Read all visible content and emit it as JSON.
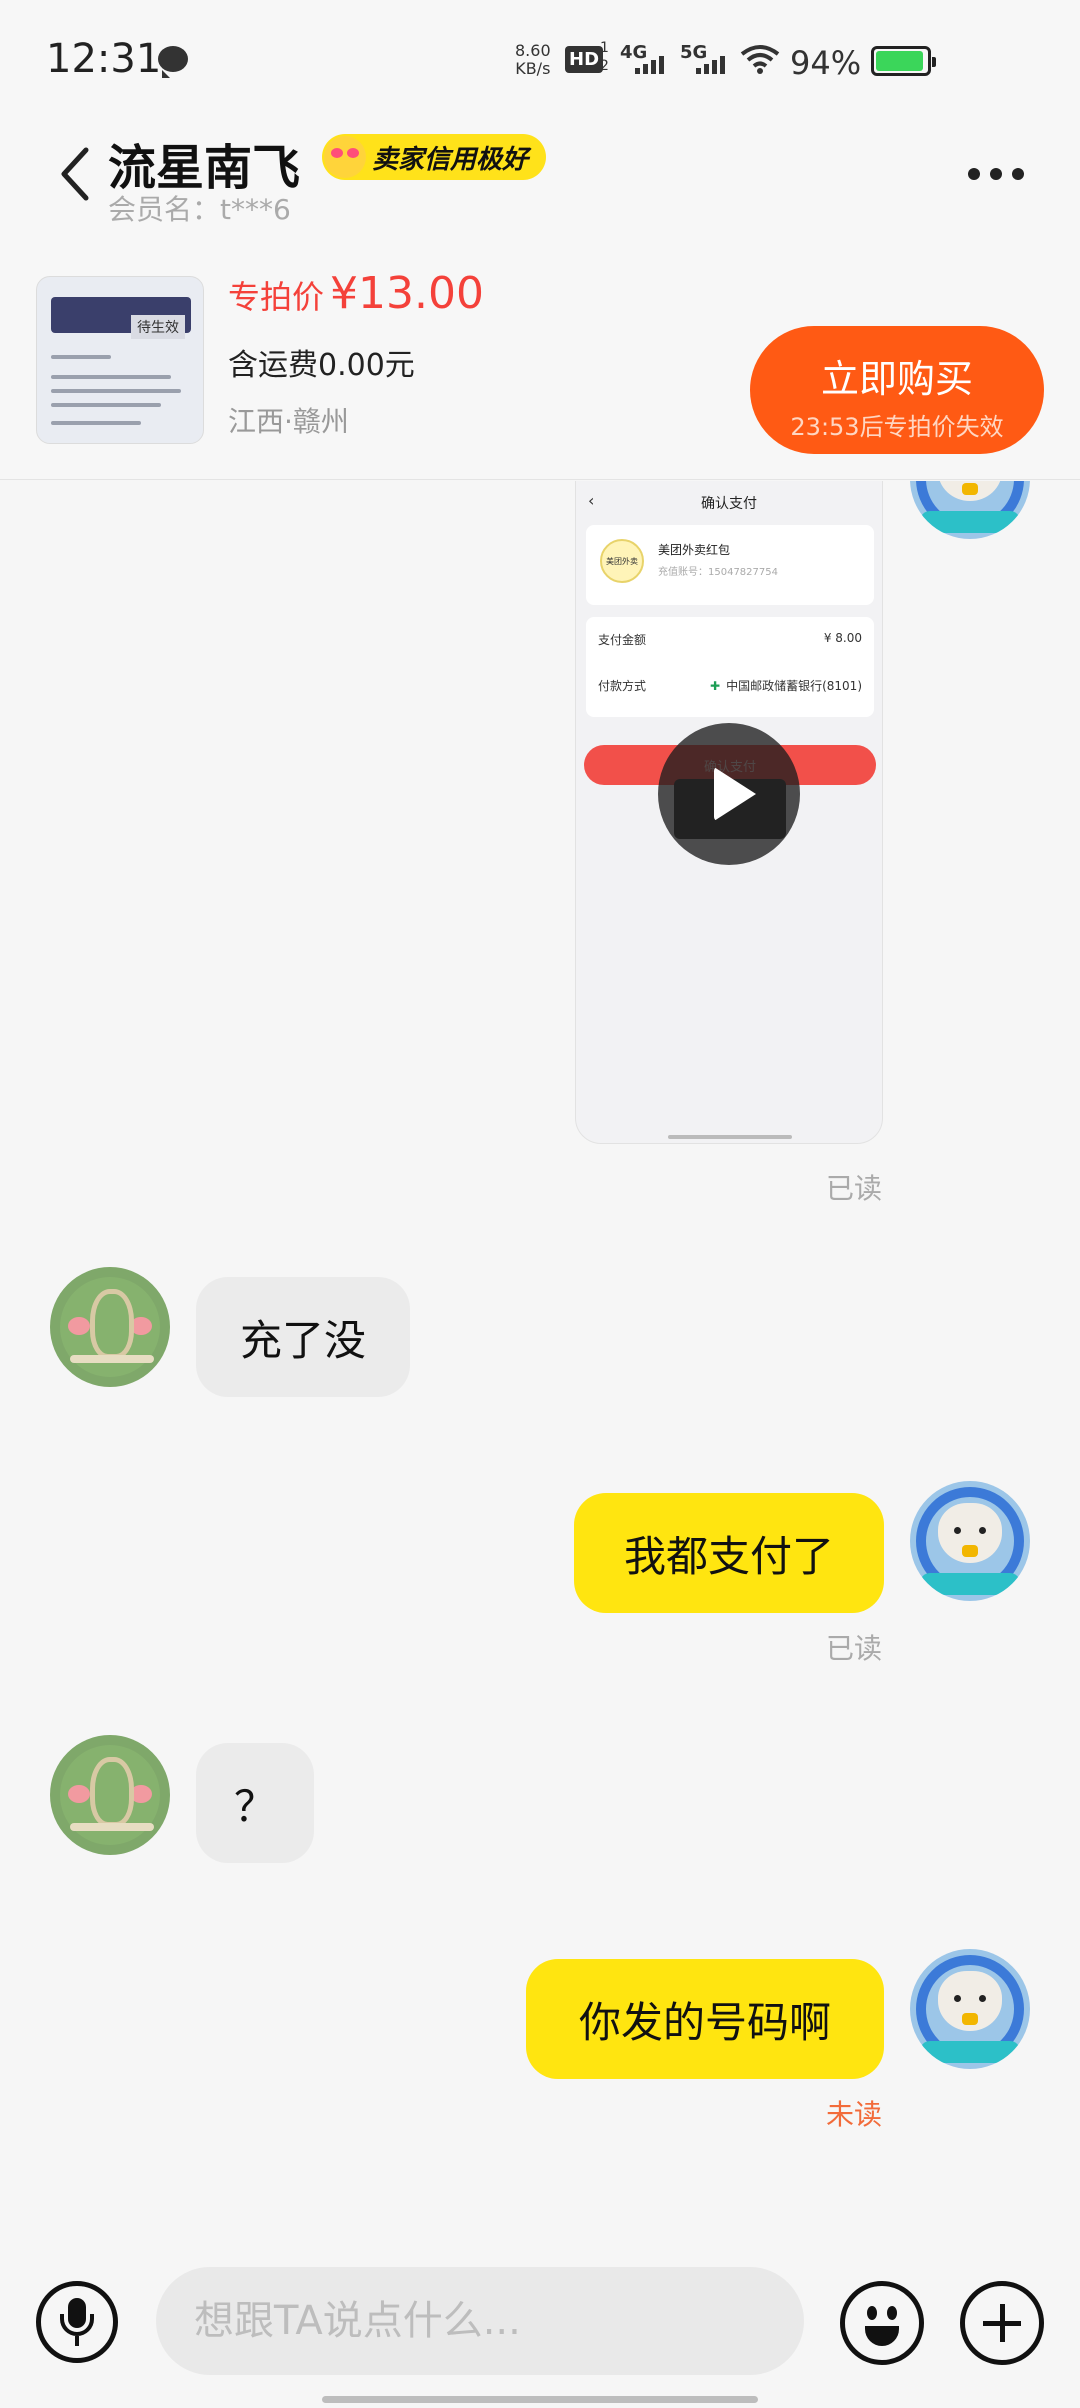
{
  "status_bar": {
    "time": "12:31",
    "speed_value": "8.60",
    "speed_unit": "KB/s",
    "hd_label": "HD",
    "hd_sub1": "1",
    "hd_sub2": "2",
    "net1": "4G",
    "net2": "5G",
    "battery_pct": "94%",
    "battery_level": 0.94,
    "battery_color": "#3bd65a",
    "icons": [
      "chat-icon",
      "wifi-icon",
      "battery-icon"
    ]
  },
  "header": {
    "title": "流星南飞",
    "credit_badge": "卖家信用极好",
    "member": "会员名：t***6"
  },
  "product": {
    "thumb_tag": "待生效",
    "price_label": "专拍价",
    "price": "¥13.00",
    "shipping": "含运费0.00元",
    "location": "江西·赣州",
    "buy_label": "立即购买",
    "buy_sub": "23:53后专拍价失效",
    "accent_color": "#ff5a14",
    "price_color": "#f4413a"
  },
  "video_message": {
    "screen_title": "确认支付",
    "merchant_logo": "美团外卖",
    "merchant_name": "美团外卖红包",
    "account": "充值账号：15047827754",
    "amount_label": "支付金额",
    "amount_value": "¥ 8.00",
    "method_label": "付款方式",
    "method_value": "中国邮政储蓄银行(8101)",
    "confirm_label": "确认支付",
    "read_status": "已读"
  },
  "messages": [
    {
      "side": "in",
      "text": "充了没"
    },
    {
      "side": "out",
      "text": "我都支付了",
      "status": "已读"
    },
    {
      "side": "in",
      "text": "？"
    },
    {
      "side": "out",
      "text": "你发的号码啊",
      "status": "未读"
    }
  ],
  "input_bar": {
    "placeholder": "想跟TA说点什么...",
    "bubble_color": "#ffe510"
  }
}
